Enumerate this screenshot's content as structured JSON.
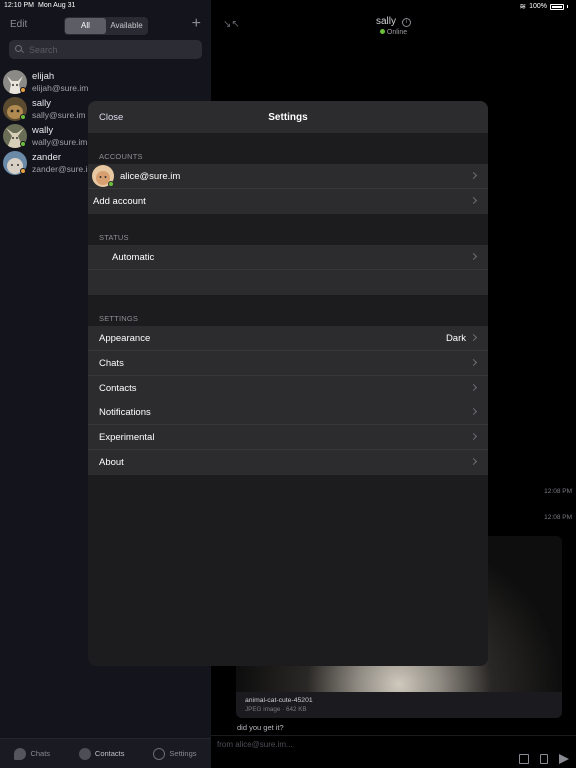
{
  "status_bar": {
    "time": "12:10 PM",
    "date": "Mon Aug 31",
    "wifi_icon": "wifi-icon",
    "battery": "100%"
  },
  "sidebar": {
    "edit_label": "Edit",
    "filter_tabs": [
      "All",
      "Available"
    ],
    "filter_selected": "All",
    "add_label": "+",
    "search_placeholder": "Search",
    "contacts": [
      {
        "name": "elijah",
        "jid": "elijah@sure.im",
        "presence_color": "#e8a040"
      },
      {
        "name": "sally",
        "jid": "sally@sure.im",
        "presence_color": "#6bbf3a"
      },
      {
        "name": "wally",
        "jid": "wally@sure.im",
        "presence_color": "#6bbf3a"
      },
      {
        "name": "zander",
        "jid": "zander@sure.im",
        "presence_color": "#e8a040"
      }
    ],
    "tabs": [
      {
        "label": "Chats",
        "icon": "chat-bubble-icon"
      },
      {
        "label": "Contacts",
        "icon": "person-icon"
      },
      {
        "label": "Settings",
        "icon": "gear-icon"
      }
    ]
  },
  "chat": {
    "peer_name": "sally",
    "peer_status": "Online",
    "online_color": "#6bbf3a",
    "timestamps": [
      "12:08 PM",
      "12:08 PM"
    ],
    "attachment": {
      "filename": "animal-cat-cute-45201",
      "meta": "JPEG image · 642 KB"
    },
    "last_message": "did you get it?",
    "composer_placeholder": "from alice@sure.im..."
  },
  "settings_modal": {
    "close_label": "Close",
    "title": "Settings",
    "accounts_header": "ACCOUNTS",
    "account_jid": "alice@sure.im",
    "account_presence_color": "#6bbf3a",
    "add_account_label": "Add account",
    "status_header": "STATUS",
    "status_value": "Automatic",
    "settings_header": "SETTINGS",
    "items": [
      {
        "label": "Appearance",
        "value": "Dark"
      },
      {
        "label": "Chats",
        "value": ""
      },
      {
        "label": "Contacts",
        "value": ""
      },
      {
        "label": "Notifications",
        "value": ""
      },
      {
        "label": "Experimental",
        "value": ""
      },
      {
        "label": "About",
        "value": ""
      }
    ]
  }
}
